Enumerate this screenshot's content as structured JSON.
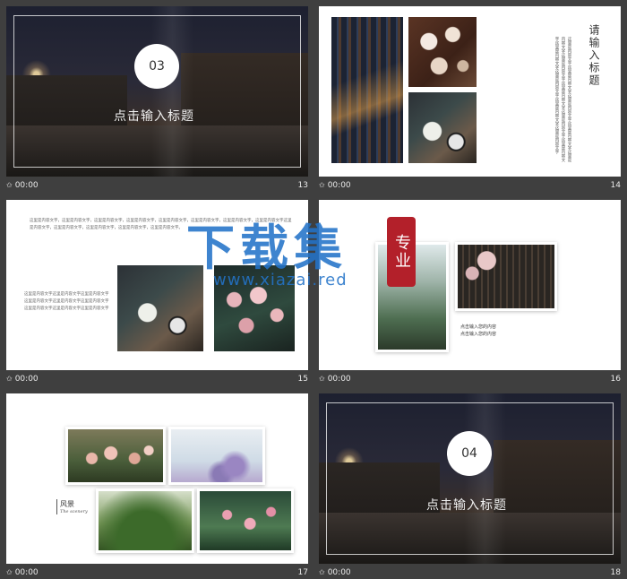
{
  "slides": [
    {
      "number": "13",
      "time": "00:00",
      "circle_label": "03",
      "title": "点击输入标题"
    },
    {
      "number": "14",
      "time": "00:00",
      "title": "请输入标题",
      "body": "这里是内容文字这里是内容文字这里是内容文字这里是内容文字这里是内容文字这里是内容文字这里是内容文字这里是内容文字这里是内容文字这里是内容文字这里是内容文字这里是内容文字这里是内容文字"
    },
    {
      "number": "15",
      "time": "00:00",
      "body_top": "这里是内容文字，这里是内容文字，这里是内容文字，这里是内容文字，这里是内容文字，这里是内容文字，这里是内容文字，这里是内容文字这里是内容文字，这里是内容文字，这里是内容文字，这里是内容文字，这里是内容文字。",
      "body_left": "这里是内容文字这里是内容文字这里是内容文字这里是内容文字这里是内容文字这里是内容文字这里是内容文字这里是内容文字这里是内容文字"
    },
    {
      "number": "16",
      "time": "00:00",
      "caption_1": "点击输入您的内容",
      "caption_2": "点击输入您的内容"
    },
    {
      "number": "17",
      "time": "00:00",
      "label_cn": "风景",
      "label_en": "The scenery"
    },
    {
      "number": "18",
      "time": "00:00",
      "circle_label": "04",
      "title": "点击输入标题"
    }
  ],
  "watermark": {
    "seal": "专业",
    "big": "下载集",
    "url": "www.xiazai.red"
  }
}
